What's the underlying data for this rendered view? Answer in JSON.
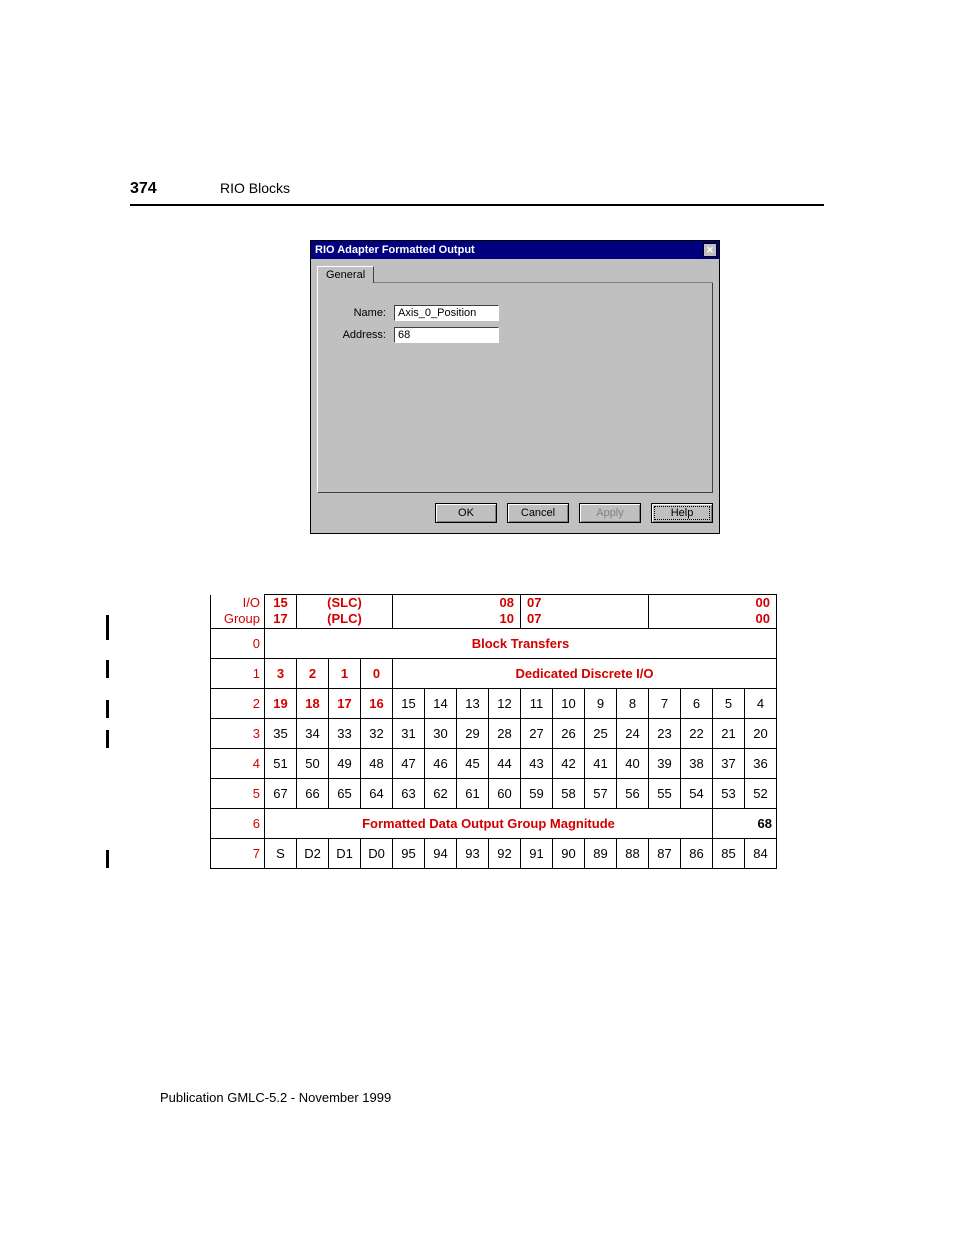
{
  "pageHeader": {
    "number": "374",
    "title": "RIO Blocks"
  },
  "dialog": {
    "title": "RIO Adapter Formatted Output",
    "tab": "General",
    "nameLabel": "Name:",
    "nameValue": "Axis_0_Position",
    "addressLabel": "Address:",
    "addressValue": "68",
    "buttons": {
      "ok": "OK",
      "cancel": "Cancel",
      "apply": "Apply",
      "help": "Help"
    }
  },
  "ioTable": {
    "rowLabelHeader": {
      "line1": "I/O",
      "line2": "Group"
    },
    "header": {
      "c0": {
        "top": "15",
        "bot": "17"
      },
      "c1": {
        "top": "(SLC)",
        "bot": "(PLC)"
      },
      "c2": {
        "top": "08",
        "bot": "10"
      },
      "c3": {
        "top": "07",
        "bot": "07"
      },
      "c4": {
        "top": "00",
        "bot": "00"
      }
    },
    "row0": {
      "label": "0",
      "text": "Block Transfers"
    },
    "row1": {
      "label": "1",
      "leftCells": [
        "3",
        "2",
        "1",
        "0"
      ],
      "rightText": "Dedicated Discrete I/O"
    },
    "row2": {
      "label": "2",
      "leftCells": [
        "19",
        "18",
        "17",
        "16"
      ],
      "cells": [
        "15",
        "14",
        "13",
        "12",
        "11",
        "10",
        "9",
        "8",
        "7",
        "6",
        "5",
        "4"
      ]
    },
    "row3": {
      "label": "3",
      "leftCells": [
        "35",
        "34",
        "33",
        "32"
      ],
      "cells": [
        "31",
        "30",
        "29",
        "28",
        "27",
        "26",
        "25",
        "24",
        "23",
        "22",
        "21",
        "20"
      ]
    },
    "row4": {
      "label": "4",
      "leftCells": [
        "51",
        "50",
        "49",
        "48"
      ],
      "cells": [
        "47",
        "46",
        "45",
        "44",
        "43",
        "42",
        "41",
        "40",
        "39",
        "38",
        "37",
        "36"
      ]
    },
    "row5": {
      "label": "5",
      "leftCells": [
        "67",
        "66",
        "65",
        "64"
      ],
      "cells": [
        "63",
        "62",
        "61",
        "60",
        "59",
        "58",
        "57",
        "56",
        "55",
        "54",
        "53",
        "52"
      ]
    },
    "row6": {
      "label": "6",
      "text": "Formatted Data Output Group Magnitude",
      "value": "68"
    },
    "row7": {
      "label": "7",
      "leftCells": [
        "S",
        "D2",
        "D1",
        "D0"
      ],
      "cells": [
        "95",
        "94",
        "93",
        "92",
        "91",
        "90",
        "89",
        "88",
        "87",
        "86",
        "85",
        "84"
      ]
    }
  },
  "publication": "Publication GMLC-5.2 - November 1999"
}
